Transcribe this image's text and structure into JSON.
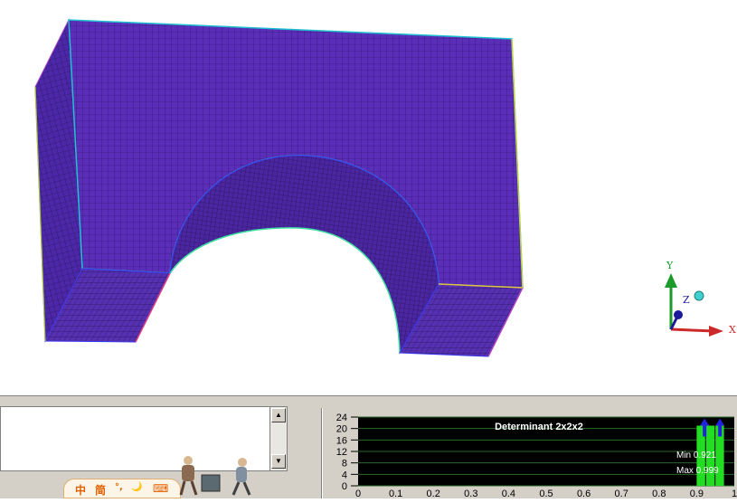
{
  "viewport": {
    "mesh_color": "#5a2eb8",
    "axis_labels": {
      "y": "Y",
      "z": "Z",
      "x": "X"
    },
    "axis_colors": {
      "y": "#1a9a2a",
      "x": "#cc2a2a",
      "z": "#1a1a9a"
    }
  },
  "message_panel": {
    "scroll_up_label": "▲",
    "scroll_down_label": "▼"
  },
  "ime_toolbar": {
    "items": [
      "中",
      "简",
      "°,",
      "🌙",
      "⌨"
    ]
  },
  "histogram": {
    "title": "Determinant 2x2x2",
    "min_label": "Min 0.921",
    "max_label": "Max 0.999",
    "bar_color": "#22dd22",
    "marker_color": "#2222dd"
  },
  "chart_data": {
    "type": "bar",
    "title": "Determinant 2x2x2",
    "x_ticks": [
      "0",
      "0.1",
      "0.2",
      "0.3",
      "0.4",
      "0.5",
      "0.6",
      "0.7",
      "0.8",
      "0.9",
      "1"
    ],
    "y_ticks": [
      "0",
      "4",
      "8",
      "12",
      "16",
      "20",
      "24"
    ],
    "xlim": [
      0,
      1
    ],
    "ylim": [
      0,
      24
    ],
    "bins": [
      {
        "x0": 0.9,
        "x1": 0.925,
        "value": 21
      },
      {
        "x0": 0.925,
        "x1": 0.95,
        "value": 21
      },
      {
        "x0": 0.95,
        "x1": 0.975,
        "value": 21
      }
    ],
    "markers": [
      0.921,
      0.999
    ],
    "annotations": [
      "Min 0.921",
      "Max 0.999"
    ]
  }
}
